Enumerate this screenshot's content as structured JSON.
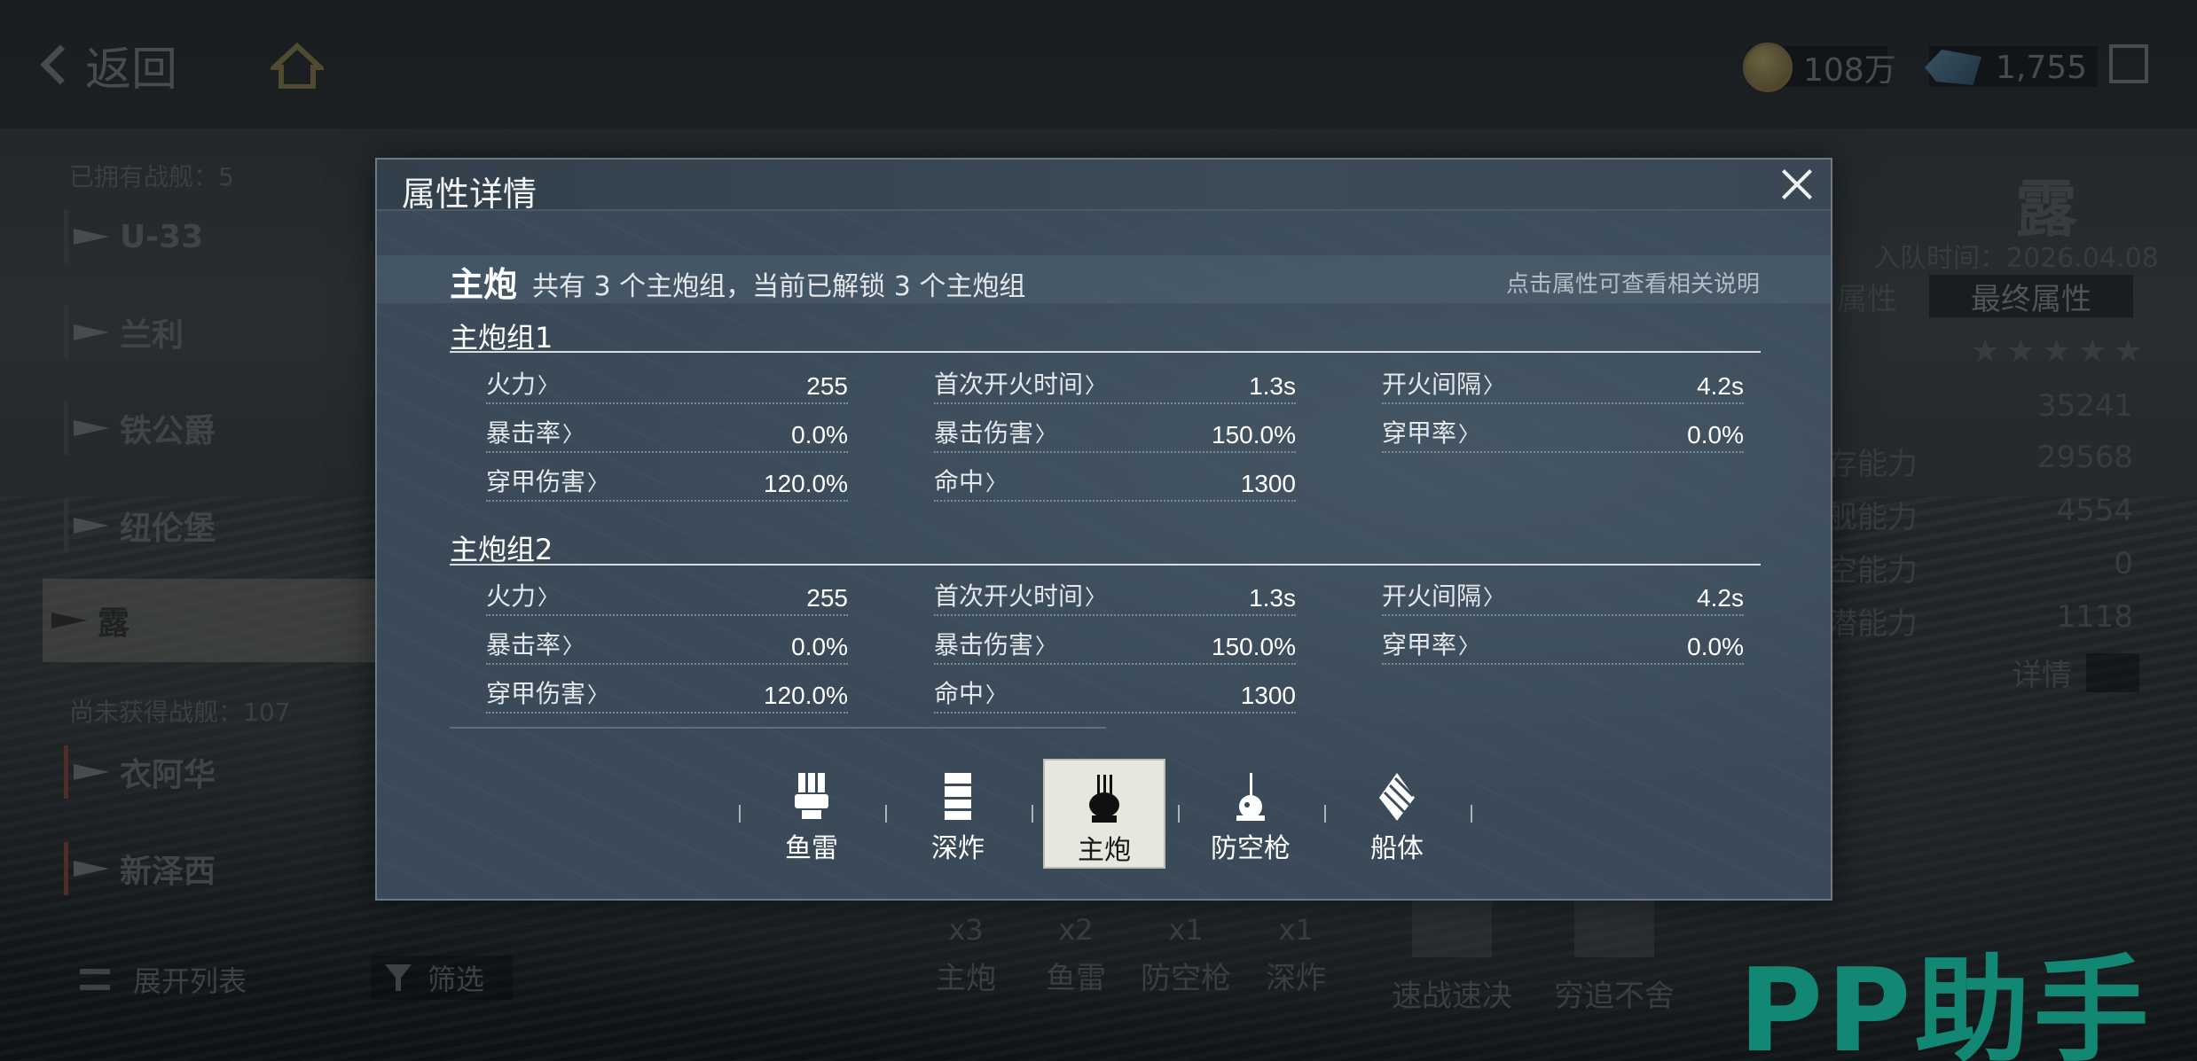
{
  "topbar": {
    "back_label": "返回",
    "coins": "108万",
    "gems": "1,755"
  },
  "shiplist": {
    "owned_label": "已拥有战舰：5",
    "owned": [
      "U-33",
      "兰利",
      "铁公爵",
      "纽伦堡",
      "露"
    ],
    "selected": "露",
    "unowned_label": "尚未获得战舰：107",
    "unowned": [
      "衣阿华",
      "新泽西"
    ],
    "expand_label": "展开列表",
    "filter_label": "筛选"
  },
  "right_panel": {
    "ship_name": "露",
    "join_time": "入队时间：2026.04.08",
    "tab_attr": "属性",
    "tab_final": "最终属性",
    "stars": "★★★★★",
    "power": "35241",
    "rows": [
      {
        "label": "存能力",
        "value": "29568"
      },
      {
        "label": "舰能力",
        "value": "4554"
      },
      {
        "label": "空能力",
        "value": "0"
      },
      {
        "label": "潜能力",
        "value": "1118"
      }
    ],
    "detail_label": "详情"
  },
  "bottom": {
    "weapons": [
      {
        "count": "x3",
        "label": "主炮"
      },
      {
        "count": "x2",
        "label": "鱼雷"
      },
      {
        "count": "x1",
        "label": "防空枪"
      },
      {
        "count": "x1",
        "label": "深炸"
      }
    ],
    "skills": [
      "速战速决",
      "穷追不舍"
    ]
  },
  "watermark": "PP助手",
  "modal": {
    "title": "属性详情",
    "section_name": "主炮",
    "section_desc": "共有 3 个主炮组，当前已解锁 3 个主炮组",
    "hint": "点击属性可查看相关说明",
    "groups": [
      {
        "title": "主炮组1",
        "stats": [
          {
            "label": "火力",
            "value": "255"
          },
          {
            "label": "首次开火时间",
            "value": "1.3s"
          },
          {
            "label": "开火间隔",
            "value": "4.2s"
          },
          {
            "label": "暴击率",
            "value": "0.0%"
          },
          {
            "label": "暴击伤害",
            "value": "150.0%"
          },
          {
            "label": "穿甲率",
            "value": "0.0%"
          },
          {
            "label": "穿甲伤害",
            "value": "120.0%"
          },
          {
            "label": "命中",
            "value": "1300"
          }
        ]
      },
      {
        "title": "主炮组2",
        "stats": [
          {
            "label": "火力",
            "value": "255"
          },
          {
            "label": "首次开火时间",
            "value": "1.3s"
          },
          {
            "label": "开火间隔",
            "value": "4.2s"
          },
          {
            "label": "暴击率",
            "value": "0.0%"
          },
          {
            "label": "暴击伤害",
            "value": "150.0%"
          },
          {
            "label": "穿甲率",
            "value": "0.0%"
          },
          {
            "label": "穿甲伤害",
            "value": "120.0%"
          },
          {
            "label": "命中",
            "value": "1300"
          }
        ]
      }
    ],
    "tabs": [
      {
        "label": "鱼雷",
        "icon": "torpedo-icon"
      },
      {
        "label": "深炸",
        "icon": "depth-charge-icon"
      },
      {
        "label": "主炮",
        "icon": "main-gun-icon",
        "active": true
      },
      {
        "label": "防空枪",
        "icon": "anti-air-gun-icon"
      },
      {
        "label": "船体",
        "icon": "hull-icon"
      }
    ]
  },
  "colors": {
    "modal_bg": "#3a4a58",
    "active_tab_bg": "#e8e7df",
    "watermark": "#18b59a"
  }
}
